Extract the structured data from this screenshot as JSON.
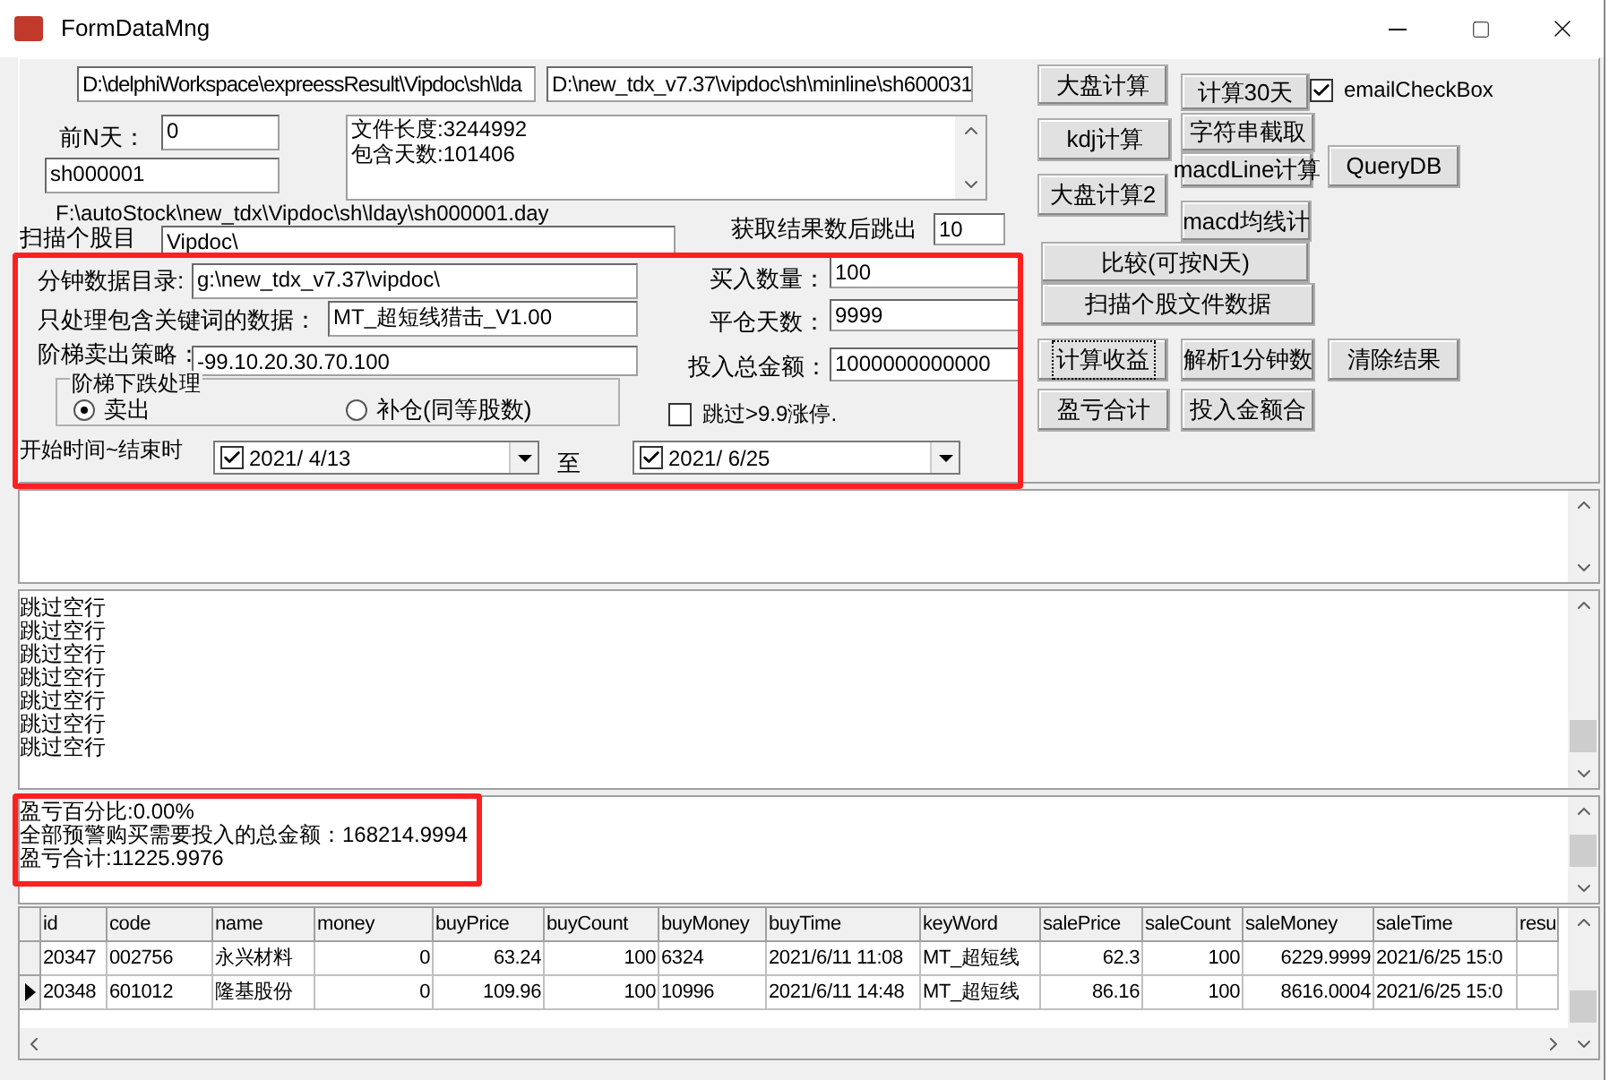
{
  "window": {
    "title": "FormDataMng"
  },
  "paths": [
    "D:\\delphiWorkspace\\expreessResult\\Vipdoc\\sh\\lda",
    "D:\\new_tdx_v7.37\\vipdoc\\sh\\minline\\sh600031"
  ],
  "days_before": {
    "label": "前N天：",
    "value": "0"
  },
  "stock_code": "sh000001",
  "info_memo": [
    "文件长度:3244992",
    "包含天数:101406"
  ],
  "file_path": "F:\\autoStock\\new_tdx\\Vipdoc\\sh\\lday\\sh000001.day",
  "scan_dir": {
    "label": "扫描个股目",
    "value": "Vipdoc\\"
  },
  "stop_after": {
    "label": "获取结果数后跳出",
    "value": "10"
  },
  "settings_left": [
    {
      "label": "分钟数据目录:",
      "value": "g:\\new_tdx_v7.37\\vipdoc\\"
    },
    {
      "label": "只处理包含关键词的数据：",
      "value": "MT_超短线猎击_V1.00"
    },
    {
      "label": "阶梯卖出策略：",
      "value": "-99.10.20.30.70.100"
    }
  ],
  "fall_group": {
    "title": "阶梯下跌处理",
    "options": [
      {
        "label": "卖出",
        "selected": true
      },
      {
        "label": "补仓(同等股数)",
        "selected": false
      }
    ]
  },
  "settings_right": [
    {
      "label": "买入数量：",
      "value": "100"
    },
    {
      "label": "平仓天数：",
      "value": "9999"
    },
    {
      "label": "投入总金额：",
      "value": "1000000000000"
    }
  ],
  "skip_limit": {
    "label": "跳过>9.9涨停.",
    "checked": false
  },
  "date_range": {
    "label": "开始时间~结束时",
    "from": {
      "value": "2021/ 4/13",
      "checked": true
    },
    "separator": "至",
    "to": {
      "value": "2021/ 6/25",
      "checked": true
    }
  },
  "buttons": [
    {
      "label": "大盘计算",
      "focused": false
    },
    {
      "label": "计算30天",
      "focused": false
    },
    {
      "label": "kdj计算",
      "focused": false
    },
    {
      "label": "字符串截取",
      "focused": false
    },
    {
      "label": "macdLine计算",
      "focused": false
    },
    {
      "label": "QueryDB",
      "focused": false
    },
    {
      "label": "大盘计算2",
      "focused": false
    },
    {
      "label": "macd均线计",
      "focused": false
    },
    {
      "label": "比较(可按N天)",
      "focused": false
    },
    {
      "label": "扫描个股文件数据",
      "focused": false
    },
    {
      "label": "计算收益",
      "focused": true
    },
    {
      "label": "解析1分钟数",
      "focused": false
    },
    {
      "label": "清除结果",
      "focused": false
    },
    {
      "label": "盈亏合计",
      "focused": false
    },
    {
      "label": "投入金额合",
      "focused": false
    }
  ],
  "email_checkbox": {
    "label": "emailCheckBox",
    "checked": true
  },
  "log_lines": [
    "跳过空行",
    "跳过空行",
    "跳过空行",
    "跳过空行",
    "跳过空行",
    "跳过空行",
    "跳过空行"
  ],
  "summary": [
    "盈亏百分比:0.00%",
    "全部预警购买需要投入的总金额：168214.9994",
    "盈亏合计:11225.9976"
  ],
  "table": {
    "columns": [
      "id",
      "code",
      "name",
      "money",
      "buyPrice",
      "buyCount",
      "buyMoney",
      "buyTime",
      "keyWord",
      "salePrice",
      "saleCount",
      "saleMoney",
      "saleTime",
      "resu"
    ],
    "rows": [
      {
        "selected": false,
        "cells": [
          "20347",
          "002756",
          "永兴材料",
          "0",
          "63.24",
          "100",
          "6324",
          "2021/6/11 11:08",
          "MT_超短线",
          "62.3",
          "100",
          "6229.9999",
          "2021/6/25 15:0",
          ""
        ]
      },
      {
        "selected": true,
        "cells": [
          "20348",
          "601012",
          "隆基股份",
          "0",
          "109.96",
          "100",
          "10996",
          "2021/6/11 14:48",
          "MT_超短线",
          "86.16",
          "100",
          "8616.0004",
          "2021/6/25 15:0",
          ""
        ]
      }
    ]
  }
}
